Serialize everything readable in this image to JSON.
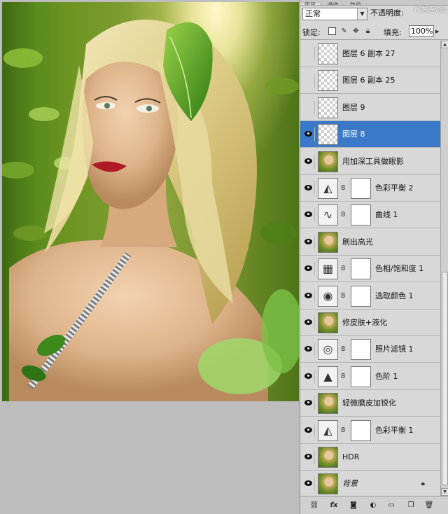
{
  "panel": {
    "tabs": [
      "图层",
      "通道",
      "路径"
    ],
    "blend_mode": "正常",
    "opacity_label": "不透明度:",
    "watermark": "PS教程论坛",
    "lock_label": "锁定:",
    "fill_label": "填充:",
    "fill_value": "100%"
  },
  "layers": [
    {
      "name": "图层 6 副本 27",
      "visible": false,
      "thumb": "checker",
      "mask": false
    },
    {
      "name": "图层 6 副本 25",
      "visible": false,
      "thumb": "checker",
      "mask": false
    },
    {
      "name": "图层 9",
      "visible": false,
      "thumb": "checker",
      "mask": false
    },
    {
      "name": "图层 8",
      "visible": true,
      "thumb": "checker",
      "mask": false,
      "selected": true
    },
    {
      "name": "用加深工具做眼影",
      "visible": true,
      "thumb": "photo",
      "mask": false
    },
    {
      "name": "色彩平衡 2",
      "visible": true,
      "thumb": "adj-balance",
      "mask": true
    },
    {
      "name": "曲线 1",
      "visible": true,
      "thumb": "adj-curves",
      "mask": true
    },
    {
      "name": "刷出高光",
      "visible": true,
      "thumb": "photo",
      "mask": false
    },
    {
      "name": "色相/饱和度 1",
      "visible": true,
      "thumb": "adj-hue",
      "mask": true
    },
    {
      "name": "选取颜色 1",
      "visible": true,
      "thumb": "adj-selective",
      "mask": true
    },
    {
      "name": "修皮肤+液化",
      "visible": true,
      "thumb": "photo",
      "mask": false
    },
    {
      "name": "照片滤镜 1",
      "visible": true,
      "thumb": "adj-photo-filter",
      "mask": true
    },
    {
      "name": "色阶 1",
      "visible": true,
      "thumb": "adj-levels",
      "mask": true
    },
    {
      "name": "轻微磨皮加锐化",
      "visible": true,
      "thumb": "photo",
      "mask": false
    },
    {
      "name": "色彩平衡 1",
      "visible": true,
      "thumb": "adj-balance",
      "mask": true
    },
    {
      "name": "HDR",
      "visible": true,
      "thumb": "photo",
      "mask": false
    },
    {
      "name": "背景",
      "visible": true,
      "thumb": "photo",
      "mask": false,
      "italic": true,
      "locked": true
    }
  ],
  "footer_icons": [
    "link-layers-icon",
    "fx-icon",
    "add-mask-icon",
    "adjustment-layer-icon",
    "new-group-icon",
    "new-layer-icon",
    "delete-layer-icon"
  ],
  "colors": {
    "selection": "#3a78c8"
  }
}
